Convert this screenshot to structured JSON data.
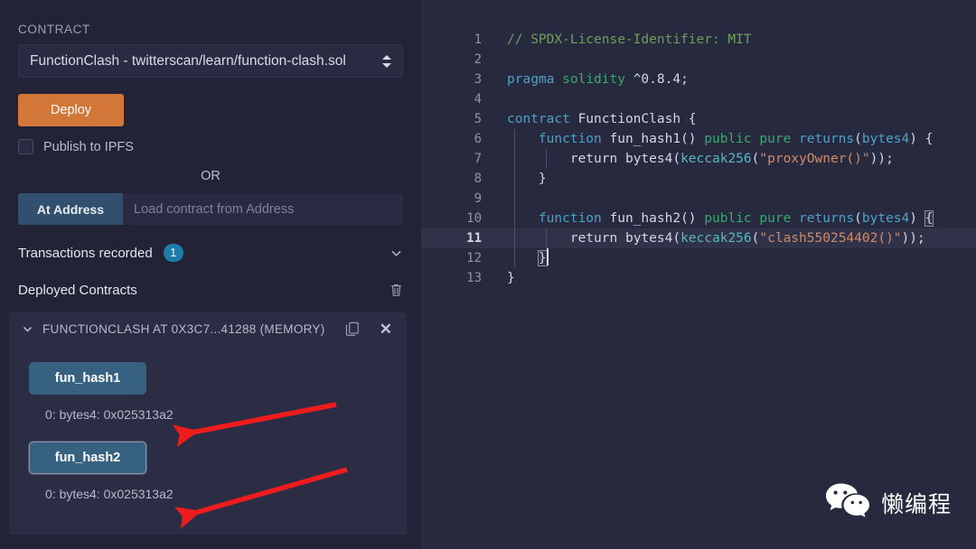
{
  "panel": {
    "contract_label": "CONTRACT",
    "contract_selected": "FunctionClash - twitterscan/learn/function-clash.sol",
    "deploy_button": "Deploy",
    "publish_ipfs_label": "Publish to IPFS",
    "or_label": "OR",
    "at_address_button": "At Address",
    "at_address_placeholder": "Load contract from Address",
    "transactions_recorded_label": "Transactions recorded",
    "transactions_recorded_count": "1",
    "deployed_contracts_label": "Deployed Contracts",
    "accent_orange": "#d2763a",
    "accent_blue": "#366181",
    "badge_blue": "#1c7ea8",
    "arrow_red": "#ee1c1c"
  },
  "contract_card": {
    "title": "FUNCTIONCLASH AT 0X3C7...41288 (MEMORY)",
    "functions": [
      {
        "name": "fun_hash1",
        "result": "0: bytes4: 0x025313a2",
        "focused": false
      },
      {
        "name": "fun_hash2",
        "result": "0: bytes4: 0x025313a2",
        "focused": true
      }
    ]
  },
  "editor": {
    "active_line": 11,
    "lines": [
      {
        "num": "1",
        "tokens": [
          {
            "t": "// SPDX-License-Identifier: MIT",
            "c": "t-comment"
          }
        ]
      },
      {
        "num": "2",
        "tokens": []
      },
      {
        "num": "3",
        "tokens": [
          {
            "t": "pragma",
            "c": "t-keyword"
          },
          {
            "t": " ",
            "c": "t-punc"
          },
          {
            "t": "solidity",
            "c": "t-kw2"
          },
          {
            "t": " ^0.8.4;",
            "c": "t-punc"
          }
        ]
      },
      {
        "num": "4",
        "tokens": []
      },
      {
        "num": "5",
        "tokens": [
          {
            "t": "contract",
            "c": "t-keyword"
          },
          {
            "t": " FunctionClash {",
            "c": "t-punc"
          }
        ]
      },
      {
        "num": "6",
        "tokens": [
          {
            "t": "    ",
            "c": "t-punc"
          },
          {
            "t": "function",
            "c": "t-keyword"
          },
          {
            "t": " fun_hash1() ",
            "c": "t-punc"
          },
          {
            "t": "public pure",
            "c": "t-kw2"
          },
          {
            "t": " ",
            "c": "t-punc"
          },
          {
            "t": "returns",
            "c": "t-keyword"
          },
          {
            "t": "(",
            "c": "t-punc"
          },
          {
            "t": "bytes4",
            "c": "t-keyword"
          },
          {
            "t": ") {",
            "c": "t-punc"
          }
        ]
      },
      {
        "num": "7",
        "tokens": [
          {
            "t": "        ",
            "c": "t-punc"
          },
          {
            "t": "return",
            "c": "t-ident"
          },
          {
            "t": " bytes4(",
            "c": "t-punc"
          },
          {
            "t": "keccak256",
            "c": "t-fn"
          },
          {
            "t": "(",
            "c": "t-punc"
          },
          {
            "t": "\"proxyOwner()\"",
            "c": "t-str"
          },
          {
            "t": "));",
            "c": "t-punc"
          }
        ]
      },
      {
        "num": "8",
        "tokens": [
          {
            "t": "    }",
            "c": "t-punc"
          }
        ]
      },
      {
        "num": "9",
        "tokens": []
      },
      {
        "num": "10",
        "tokens": [
          {
            "t": "    ",
            "c": "t-punc"
          },
          {
            "t": "function",
            "c": "t-keyword"
          },
          {
            "t": " fun_hash2() ",
            "c": "t-punc"
          },
          {
            "t": "public pure",
            "c": "t-kw2"
          },
          {
            "t": " ",
            "c": "t-punc"
          },
          {
            "t": "returns",
            "c": "t-keyword"
          },
          {
            "t": "(",
            "c": "t-punc"
          },
          {
            "t": "bytes4",
            "c": "t-keyword"
          },
          {
            "t": ") ",
            "c": "t-punc"
          },
          {
            "t": "{",
            "c": "t-punc bracket-match"
          }
        ]
      },
      {
        "num": "11",
        "tokens": [
          {
            "t": "        ",
            "c": "t-punc"
          },
          {
            "t": "return",
            "c": "t-ident"
          },
          {
            "t": " bytes4(",
            "c": "t-punc"
          },
          {
            "t": "keccak256",
            "c": "t-fn"
          },
          {
            "t": "(",
            "c": "t-punc"
          },
          {
            "t": "\"clash550254402()\"",
            "c": "t-str"
          },
          {
            "t": "));",
            "c": "t-punc"
          }
        ]
      },
      {
        "num": "12",
        "tokens": [
          {
            "t": "    ",
            "c": "t-punc"
          },
          {
            "t": "}",
            "c": "t-punc bracket-match"
          }
        ]
      },
      {
        "num": "13",
        "tokens": [
          {
            "t": "}",
            "c": "t-punc"
          }
        ]
      }
    ]
  },
  "watermark": {
    "text": "懒编程",
    "icon": "wechat-icon"
  }
}
